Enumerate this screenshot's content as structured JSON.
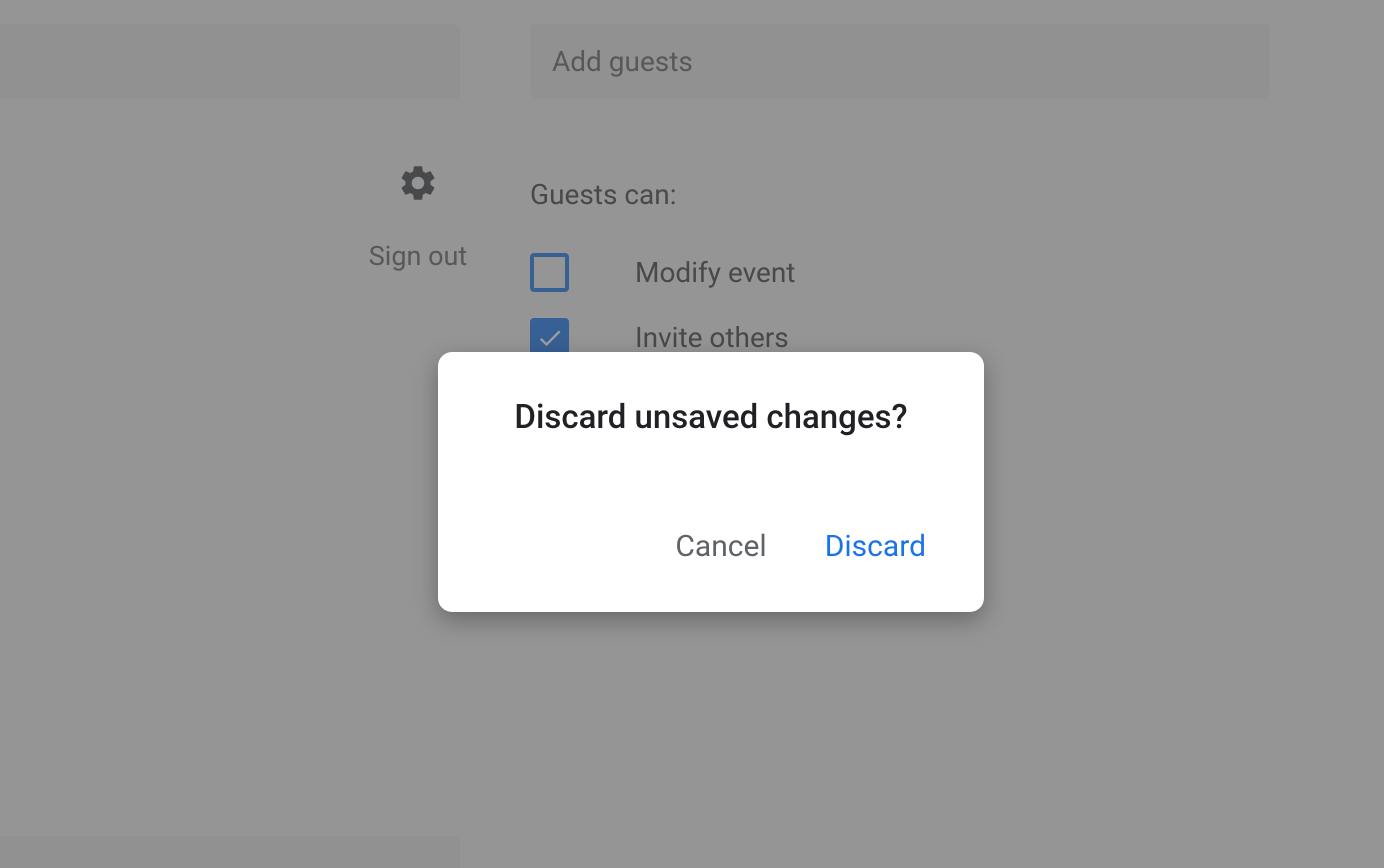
{
  "sidebar": {
    "sign_out_label": "Sign out"
  },
  "guests_panel": {
    "add_guests_placeholder": "Add guests",
    "heading": "Guests can:",
    "permissions": [
      {
        "label": "Modify event",
        "checked": false
      },
      {
        "label": "Invite others",
        "checked": true
      }
    ]
  },
  "dialog": {
    "title": "Discard unsaved changes?",
    "cancel_label": "Cancel",
    "discard_label": "Discard"
  },
  "colors": {
    "accent": "#1a73e8"
  }
}
